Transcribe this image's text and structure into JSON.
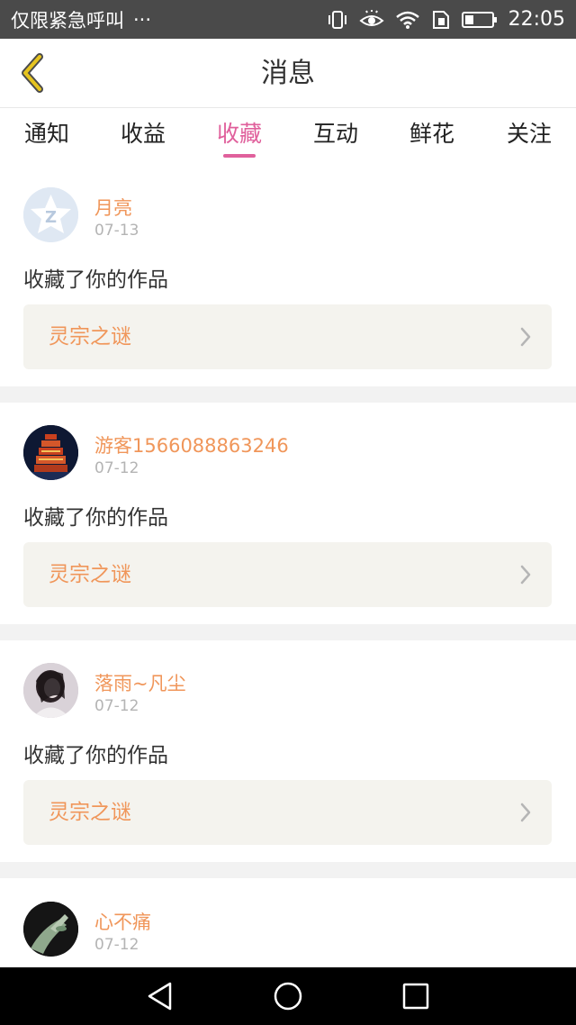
{
  "status_bar": {
    "carrier": "仅限紧急呼叫",
    "more": "···",
    "time": "22:05",
    "icons": [
      "vibrate-icon",
      "eye-icon",
      "wifi-icon",
      "sim-icon",
      "battery-icon"
    ]
  },
  "header": {
    "title": "消息",
    "back_icon": "chevron-left-icon",
    "accent_color": "#e6c41f"
  },
  "tabs": [
    {
      "label": "通知",
      "active": false
    },
    {
      "label": "收益",
      "active": false
    },
    {
      "label": "收藏",
      "active": true
    },
    {
      "label": "互动",
      "active": false
    },
    {
      "label": "鲜花",
      "active": false
    },
    {
      "label": "关注",
      "active": false
    }
  ],
  "active_color": "#e0609c",
  "name_color": "#f0965a",
  "items": [
    {
      "username": "月亮",
      "date": "07-13",
      "action": "收藏了你的作品",
      "work": "灵宗之谜",
      "avatar": "qq-star-avatar"
    },
    {
      "username": "游客1566088863246",
      "date": "07-12",
      "action": "收藏了你的作品",
      "work": "灵宗之谜",
      "avatar": "pagoda-avatar"
    },
    {
      "username": "落雨~凡尘",
      "date": "07-12",
      "action": "收藏了你的作品",
      "work": "灵宗之谜",
      "avatar": "girl-photo-avatar"
    },
    {
      "username": "心不痛",
      "date": "07-12",
      "action": "",
      "work": "",
      "avatar": "hand-photo-avatar"
    }
  ],
  "nav_bar": {
    "buttons": [
      "back-triangle-icon",
      "home-circle-icon",
      "recents-square-icon"
    ]
  }
}
